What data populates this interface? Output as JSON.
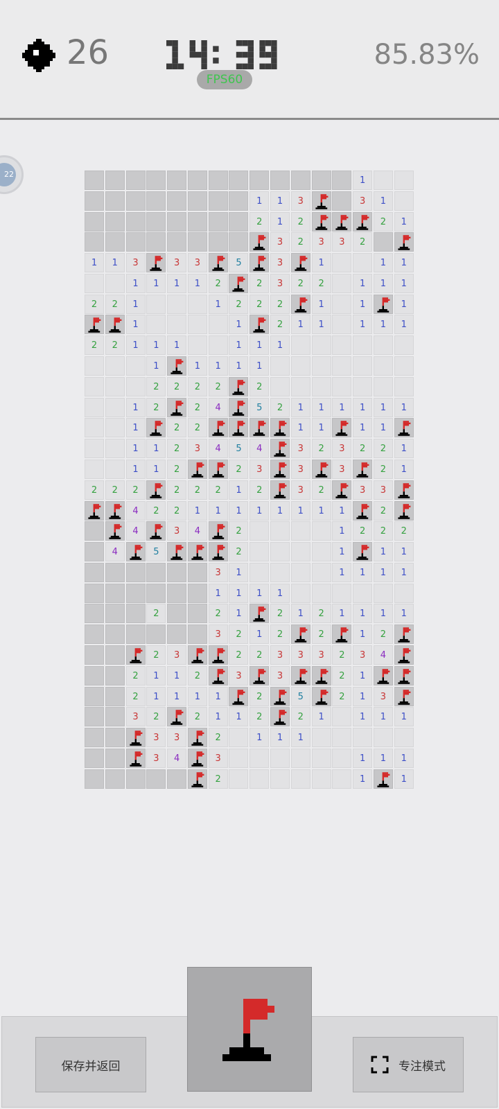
{
  "header": {
    "mine_icon": "mine-icon",
    "mines_remaining": "26",
    "timer": "14: 39",
    "fps": "FPS60",
    "progress": "85.83%"
  },
  "side_tab": {
    "label": "22"
  },
  "board": {
    "columns": 16,
    "rows_count": 30,
    "legend": {
      "H": "hidden",
      ".": "revealed-empty",
      "F": "flag",
      "1-8": "revealed-number"
    },
    "rows": [
      "HHHHHHHHHHHHH1..",
      "HHHHHHHH113FH31.",
      "HHHHHHHH212FFF21",
      "HHHHHHHHF32332HF",
      "113F33F5F3F1..11",
      "..11112F2322.111",
      "221...1222F1.1F1",
      "FF1....1F211.111",
      "22111..111......",
      "...1F1111.......",
      "...2222F2.......",
      "..12F24F52111111",
      "..1F22FFFF11F11F",
      "..1123454F323221",
      "..112FF23F3F3F21",
      "222F22212F32F33F",
      "FF42211111111F2F",
      "HF4F34F2....1222",
      "H4F5FFF2....1F11F",
      "HHHHHH31....11111",
      "HHHHHH1111......",
      "HHH2HH21F2121111",
      "HHHHHH3212F2F12F",
      "HHF23FF22333234F",
      "HH2112F3F3FF21FF3",
      "HH21111F2F5F213F2",
      "HH32F2112F21.111",
      "HHF33F2.111.....",
      "HHF34F3......111",
      "HHHHHF2......1F1"
    ]
  },
  "bottom": {
    "save_label": "保存并返回",
    "focus_label": "专注模式",
    "focus_icon": "expand-icon",
    "mode_icon": "flag-icon"
  },
  "colors": {
    "number_1": "#3d4fc7",
    "number_2": "#35a140",
    "number_3": "#c83636",
    "number_4": "#8a2bc0",
    "number_5": "#1f7fa0",
    "flag": "#d42a2a",
    "fps": "#3fc44f"
  }
}
